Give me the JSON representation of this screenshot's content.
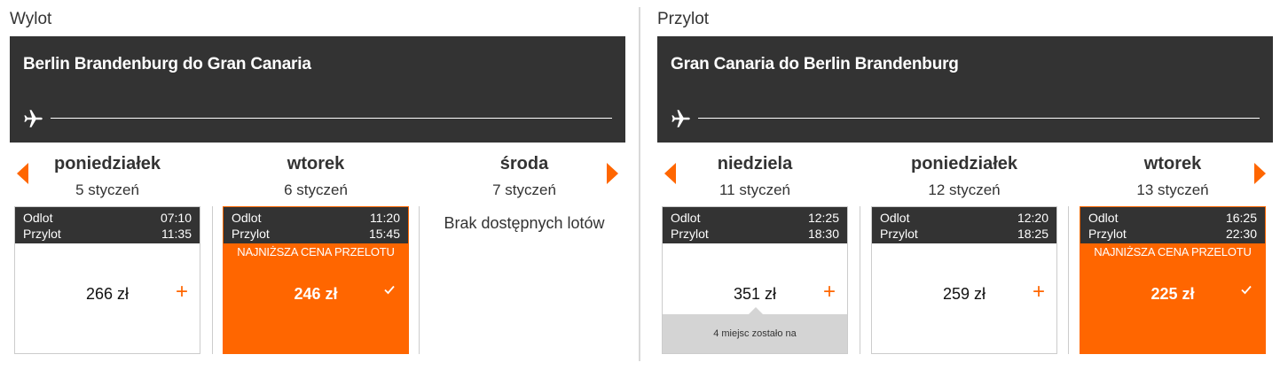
{
  "outbound": {
    "title": "Wylot",
    "route": "Berlin Brandenburg do Gran Canaria",
    "days": [
      {
        "day": "poniedziałek",
        "date": "5 styczeń",
        "flight": {
          "depart_label": "Odlot",
          "depart_time": "07:10",
          "arrive_label": "Przylot",
          "arrive_time": "11:35",
          "price": "266 zł",
          "selected": false
        }
      },
      {
        "day": "wtorek",
        "date": "6 styczeń",
        "flight": {
          "depart_label": "Odlot",
          "depart_time": "11:20",
          "arrive_label": "Przylot",
          "arrive_time": "15:45",
          "lowest_label": "NAJNIŻSZA CENA PRZELOTU",
          "price": "246 zł",
          "selected": true
        }
      },
      {
        "day": "środa",
        "date": "7 styczeń",
        "no_flights": "Brak dostępnych lotów"
      }
    ]
  },
  "inbound": {
    "title": "Przylot",
    "route": "Gran Canaria do Berlin Brandenburg",
    "days": [
      {
        "day": "niedziela",
        "date": "11 styczeń",
        "flight": {
          "depart_label": "Odlot",
          "depart_time": "12:25",
          "arrive_label": "Przylot",
          "arrive_time": "18:30",
          "price": "351 zł",
          "seats_note": "4 miejsc zostało na",
          "selected": false
        }
      },
      {
        "day": "poniedziałek",
        "date": "12 styczeń",
        "flight": {
          "depart_label": "Odlot",
          "depart_time": "12:20",
          "arrive_label": "Przylot",
          "arrive_time": "18:25",
          "price": "259 zł",
          "selected": false
        }
      },
      {
        "day": "wtorek",
        "date": "13 styczeń",
        "flight": {
          "depart_label": "Odlot",
          "depart_time": "16:25",
          "arrive_label": "Przylot",
          "arrive_time": "22:30",
          "lowest_label": "NAJNIŻSZA CENA PRZELOTU",
          "price": "225 zł",
          "selected": true
        }
      }
    ]
  },
  "icons": {
    "plane": "plane-icon",
    "prev": "chevron-left-icon",
    "next": "chevron-right-icon",
    "add": "plus-icon",
    "check": "check-icon"
  },
  "colors": {
    "accent": "#ff6600",
    "banner": "#333333",
    "note": "#d4d4d4"
  }
}
